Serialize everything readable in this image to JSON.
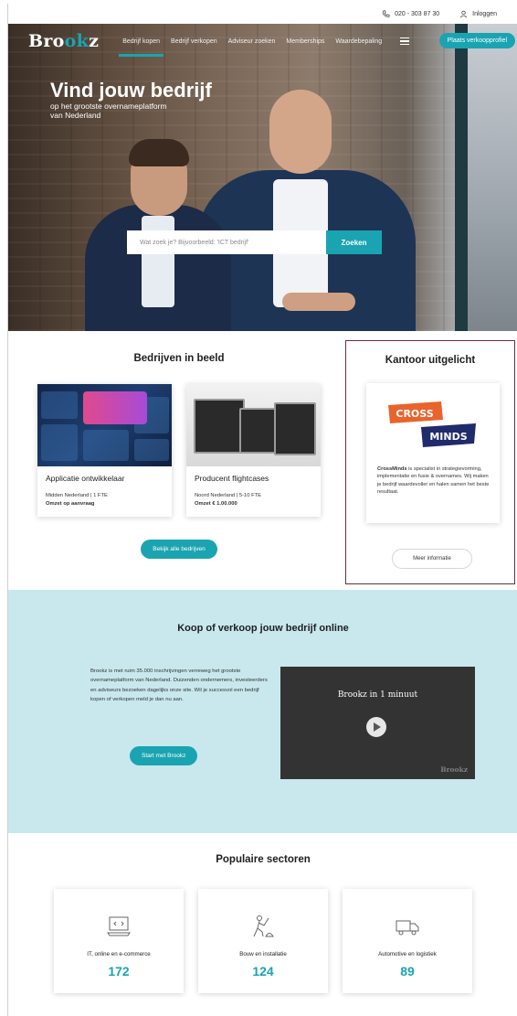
{
  "utility": {
    "phone": "020 - 303 87 30",
    "login": "Inloggen"
  },
  "nav": {
    "logo_pre": "Bro",
    "logo_accent": "ok",
    "logo_post": "z",
    "links": [
      "Bedrijf kopen",
      "Bedrijf verkopen",
      "Adviseur zoeken",
      "Memberships",
      "Waardebepaling"
    ],
    "cta": "Plaats verkoopprofiel"
  },
  "hero": {
    "title": "Vind jouw bedrijf",
    "subtitle_line1": "op het grootste overnameplatform",
    "subtitle_line2": "van Nederland",
    "search_placeholder": "Wat zoek je? Bijvoorbeeld: 'ICT bedrijf'",
    "search_button": "Zoeken"
  },
  "bedrijven": {
    "title": "Bedrijven in beeld",
    "cards": [
      {
        "name": "Applicatie ontwikkelaar",
        "location": "Midden Nederland | 1 FTE",
        "turnover": "Omzet op aanvraag"
      },
      {
        "name": "Producent flightcases",
        "location": "Noord Nederland | 5-10 FTE",
        "turnover": "Omzet € 1.00.000"
      }
    ],
    "button": "Bekijk alle bedrijven"
  },
  "kantoor": {
    "title": "Kantoor uitgelicht",
    "logo_top": "CROSS",
    "logo_bottom": "MINDS",
    "company": "CrossMinds",
    "description": "is specialist in strategievorming, implementatie en fusie & overnames. Wij maken je bedrijf waardevoller en halen samen het beste resultaat.",
    "button": "Meer informatie"
  },
  "kov": {
    "title": "Koop of verkoop jouw bedrijf online",
    "text": "Brookz is met ruim 35.000 inschrijvingen verreweg het grootste overnameplatform van Nederland. Duizenden ondernemers, investeerders en adviseurs bezoeken dagelijks onze site. Wil je succesvol een bedrijf kopen of verkopen meld je dan nu aan.",
    "button": "Start met Brookz",
    "video_title": "Brookz in 1 minuut",
    "video_brand": "Brookz"
  },
  "sectoren": {
    "title": "Populaire sectoren",
    "items": [
      {
        "name": "IT, online en e-commerce",
        "count": "172",
        "icon": "computer-icon"
      },
      {
        "name": "Bouw en installatie",
        "count": "124",
        "icon": "construction-worker-icon"
      },
      {
        "name": "Automotive en logistiek",
        "count": "89",
        "icon": "truck-icon"
      }
    ]
  },
  "colors": {
    "accent": "#1aa4b1",
    "highlight_border": "#6b2e3c",
    "band": "#c8e8ee"
  }
}
